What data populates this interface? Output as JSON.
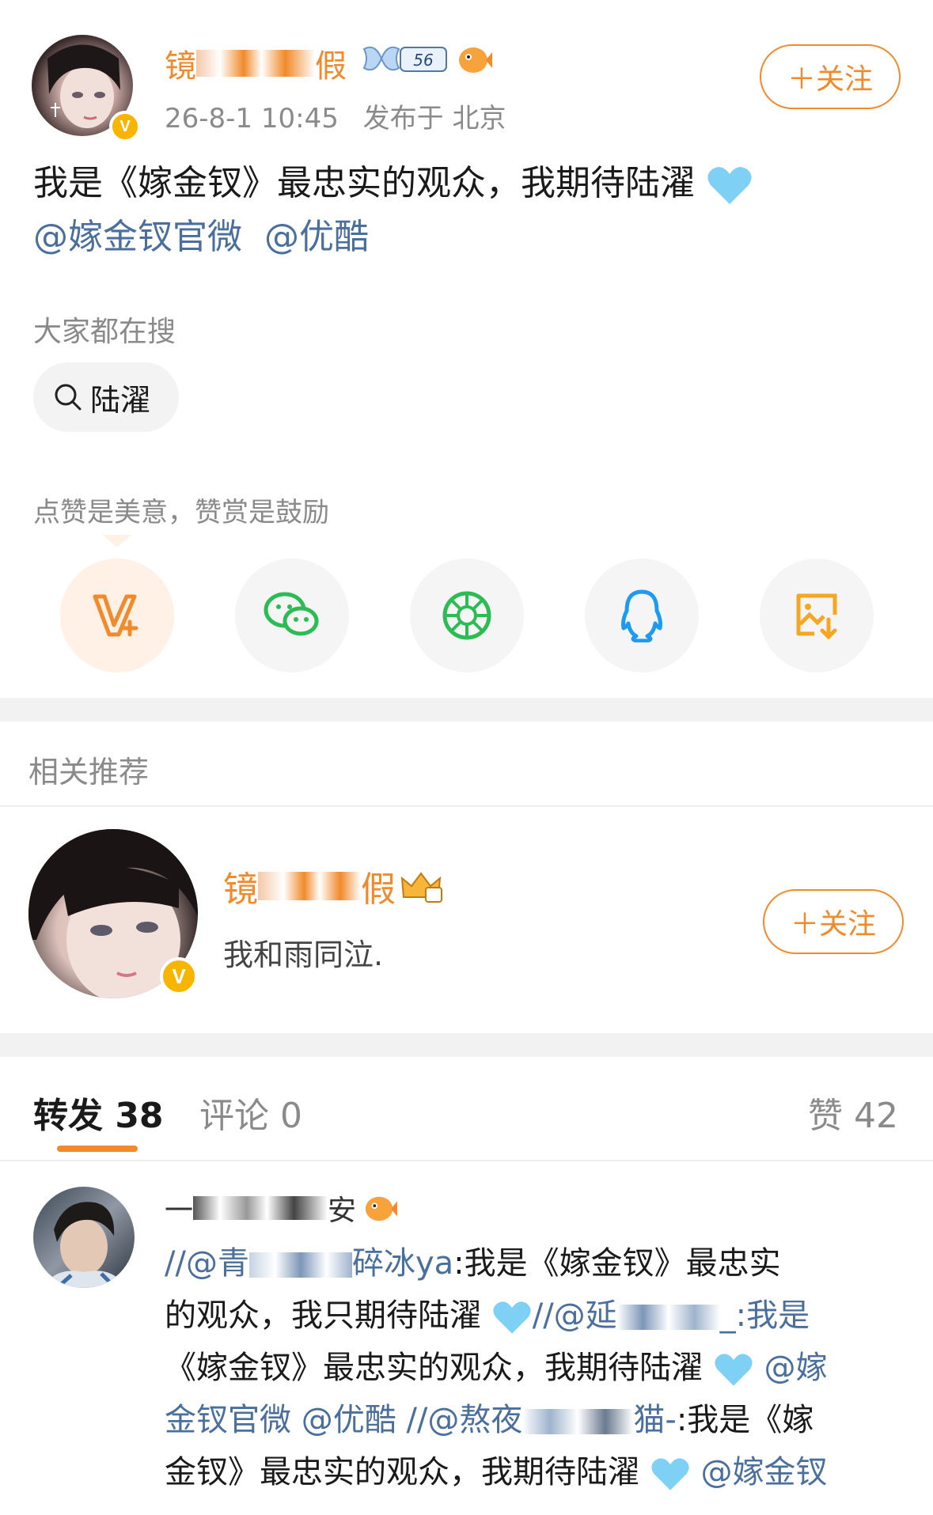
{
  "post": {
    "author_name_visible": [
      "镜",
      "假"
    ],
    "timestamp": "26-8-1 10:45",
    "location": "发布于 北京",
    "follow_label": "＋关注",
    "level_badge": "56",
    "text_line1": "我是《嫁金钗》最忠实的观众，我期待陆濯",
    "mention1": "@嫁金钗官微",
    "mention2": "@优酷"
  },
  "search": {
    "title": "大家都在搜",
    "chip": "陆濯"
  },
  "share": {
    "hint": "点赞是美意，赞赏是鼓励",
    "items": [
      {
        "icon": "weibo-reward-icon",
        "color": "#f08a2a"
      },
      {
        "icon": "wechat-icon",
        "color": "#2dbb55"
      },
      {
        "icon": "moments-icon",
        "color": "#2dbb55"
      },
      {
        "icon": "qq-icon",
        "color": "#1e9bf0"
      },
      {
        "icon": "save-image-icon",
        "color": "#f5a623"
      }
    ]
  },
  "related": {
    "title": "相关推荐",
    "name_visible": [
      "镜",
      "假"
    ],
    "bio": "我和雨同泣.",
    "follow_label": "＋关注"
  },
  "tabs": {
    "repost": "转发 38",
    "comment": "评论 0",
    "like": "赞 42"
  },
  "repost_item": {
    "name_visible": [
      "一",
      "安"
    ],
    "line1_a": "//@青",
    "line1_b": "碎冰ya",
    "line1_c": ":我是《嫁金钗》最忠实",
    "line2_a": "的观众，我只期待陆濯",
    "line2_b": "//@延",
    "line2_c": "_:我是",
    "line3_a": "《嫁金钗》最忠实的观众，我期待陆濯",
    "line3_b": "@嫁",
    "line4_a": "金钗官微 @优酷",
    "line4_b": "//@熬夜",
    "line4_c": "猫-",
    "line4_d": ":我是《嫁",
    "line5_a": "金钗》最忠实的观众，我期待陆濯",
    "line5_b": "@嫁金钗"
  },
  "colors": {
    "accent": "#f08a2a",
    "link": "#4a6f9c",
    "gray": "#8a8a8a"
  }
}
